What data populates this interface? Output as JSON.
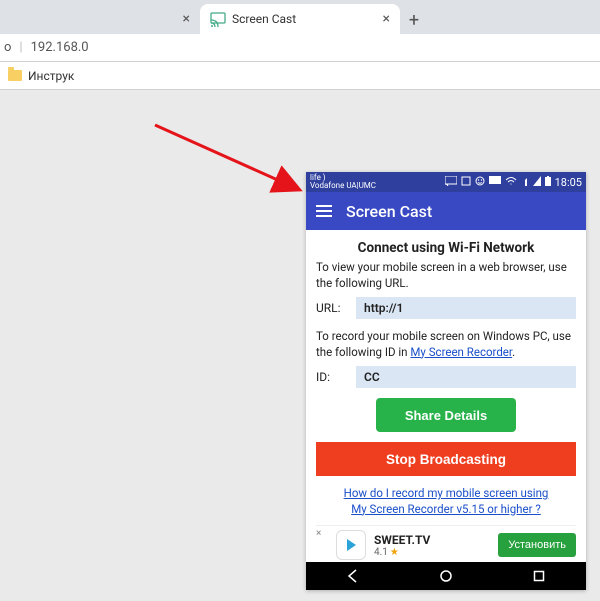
{
  "browser": {
    "tabs": [
      {
        "title": "",
        "active": false
      },
      {
        "title": "Screen Cast",
        "active": true
      }
    ],
    "new_tab": "+",
    "address_prefix": "o",
    "address": "192.168.0",
    "bookmark": "Инструк"
  },
  "phone": {
    "status": {
      "carrier_line1": "life )",
      "carrier_line2": "Vodafone UA|UMC",
      "time": "18:05"
    },
    "appbar": {
      "title": "Screen Cast"
    },
    "main": {
      "heading": "Connect using Wi-Fi Network",
      "view_text": "To view your mobile screen in a web browser, use the following URL.",
      "url_label": "URL:",
      "url_value": "http://1",
      "record_text_pre": "To record your mobile screen on Windows PC, use the following ID in ",
      "record_link": "My Screen Recorder",
      "record_text_post": ".",
      "id_label": "ID:",
      "id_value": "CC",
      "share_label": "Share Details",
      "stop_label": "Stop Broadcasting",
      "faq_line1": "How do I record my mobile screen using",
      "faq_line2": "My Screen Recorder v5.15 or higher ?"
    },
    "ad": {
      "title": "SWEET.TV",
      "rating": "4.1",
      "install": "Установить",
      "close": "×"
    }
  }
}
